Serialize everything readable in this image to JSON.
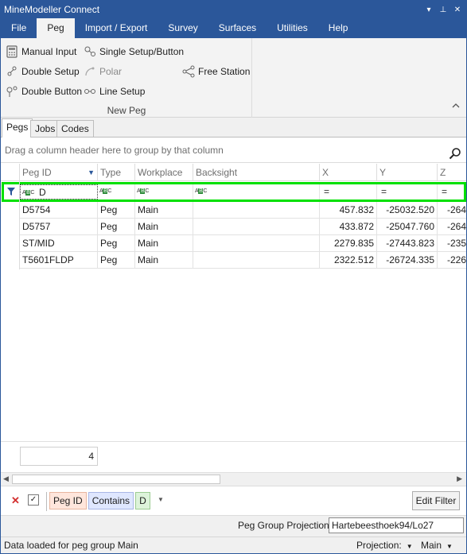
{
  "window": {
    "title": "MineModeller Connect",
    "dropdown_icon": "▾",
    "pin_icon": "⊥",
    "close_icon": "✕"
  },
  "ribbon_tabs": [
    "File",
    "Peg",
    "Import / Export",
    "Survey",
    "Surfaces",
    "Utilities",
    "Help"
  ],
  "ribbon": {
    "items": {
      "manual_input": "Manual Input",
      "double_setup": "Double Setup",
      "double_button": "Double Button",
      "single_setup": "Single Setup/Button",
      "polar": "Polar",
      "line_setup": "Line Setup",
      "free_station": "Free Station"
    },
    "group_label": "New Peg"
  },
  "sub_tabs": [
    "Pegs",
    "Jobs",
    "Codes"
  ],
  "grid": {
    "group_hint": "Drag a column header here to group by that column",
    "columns": [
      "Peg ID",
      "Type",
      "Workplace",
      "Backsight",
      "X",
      "Y",
      "Z"
    ],
    "filter_value": "D",
    "rows": [
      {
        "peg_id": "D5754",
        "type": "Peg",
        "workplace": "Main",
        "backsight": "",
        "x": "457.832",
        "y": "-25032.520",
        "z": "-264"
      },
      {
        "peg_id": "D5757",
        "type": "Peg",
        "workplace": "Main",
        "backsight": "",
        "x": "433.872",
        "y": "-25047.760",
        "z": "-264"
      },
      {
        "peg_id": "ST/MID",
        "type": "Peg",
        "workplace": "Main",
        "backsight": "",
        "x": "2279.835",
        "y": "-27443.823",
        "z": "-235"
      },
      {
        "peg_id": "T5601FLDP",
        "type": "Peg",
        "workplace": "Main",
        "backsight": "",
        "x": "2322.512",
        "y": "-26724.335",
        "z": "-226"
      }
    ],
    "total_count": "4"
  },
  "filter_bar": {
    "property": "Peg ID",
    "operator": "Contains",
    "value": "D",
    "edit_button": "Edit Filter"
  },
  "projection": {
    "label": "Peg Group Projection:",
    "value": "Hartebeesthoek94/Lo27"
  },
  "status": {
    "message": "Data loaded for peg group Main",
    "projection_label": "Projection:",
    "group_label": "Main"
  }
}
